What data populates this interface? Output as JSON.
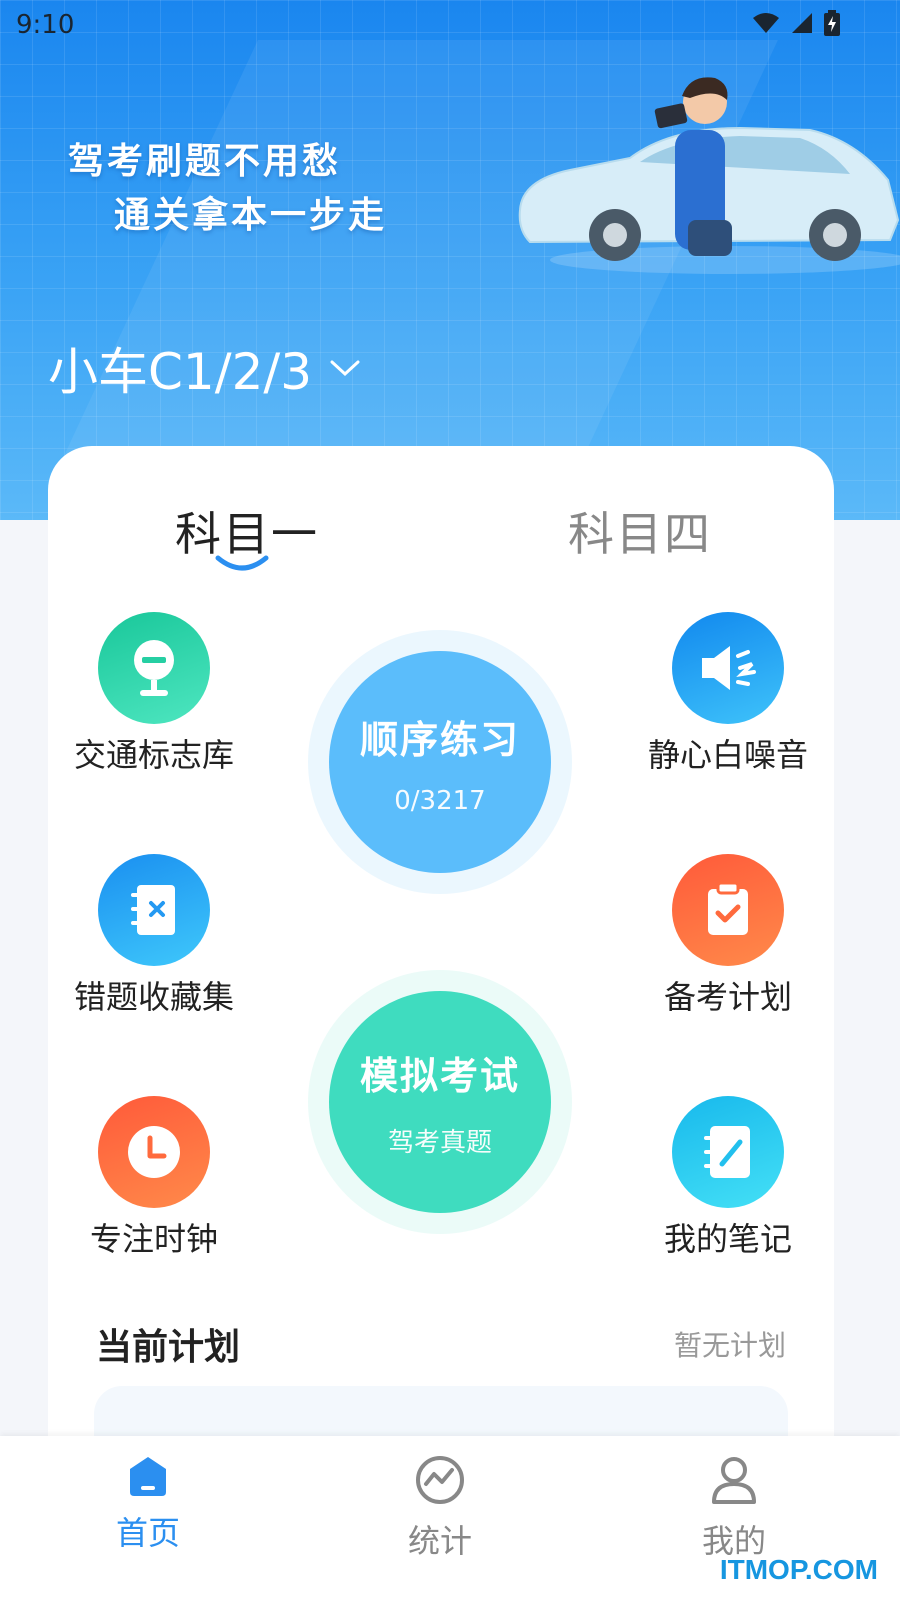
{
  "status_bar": {
    "time": "9:10"
  },
  "hero": {
    "slogan_line1": "驾考刷题不用愁",
    "slogan_line2": "通关拿本一步走",
    "license_type": "小车C1/2/3"
  },
  "tabs": [
    {
      "label": "科目一",
      "active": true
    },
    {
      "label": "科目四",
      "active": false
    }
  ],
  "features": {
    "traffic_signs": "交通标志库",
    "white_noise": "静心白噪音",
    "wrong_questions": "错题收藏集",
    "study_plan": "备考计划",
    "focus_clock": "专注时钟",
    "my_notes": "我的笔记"
  },
  "sequential_practice": {
    "title": "顺序练习",
    "progress": "0/3217"
  },
  "mock_exam": {
    "title": "模拟考试",
    "subtitle": "驾考真题"
  },
  "current_plan": {
    "title": "当前计划",
    "status": "暂无计划"
  },
  "bottom_nav": [
    {
      "label": "首页",
      "active": true
    },
    {
      "label": "统计",
      "active": false
    },
    {
      "label": "我的",
      "active": false
    }
  ],
  "watermark": "ITMOP.COM",
  "colors": {
    "primary_blue": "#2b8ff0",
    "practice_blue": "#5bbdfb",
    "exam_green": "#3fdcbf",
    "traffic_green": "#2fd3a6",
    "noise_blue": "#1e9cf3",
    "plan_orange": "#ff6a3d",
    "notes_cyan": "#29d0f0"
  }
}
